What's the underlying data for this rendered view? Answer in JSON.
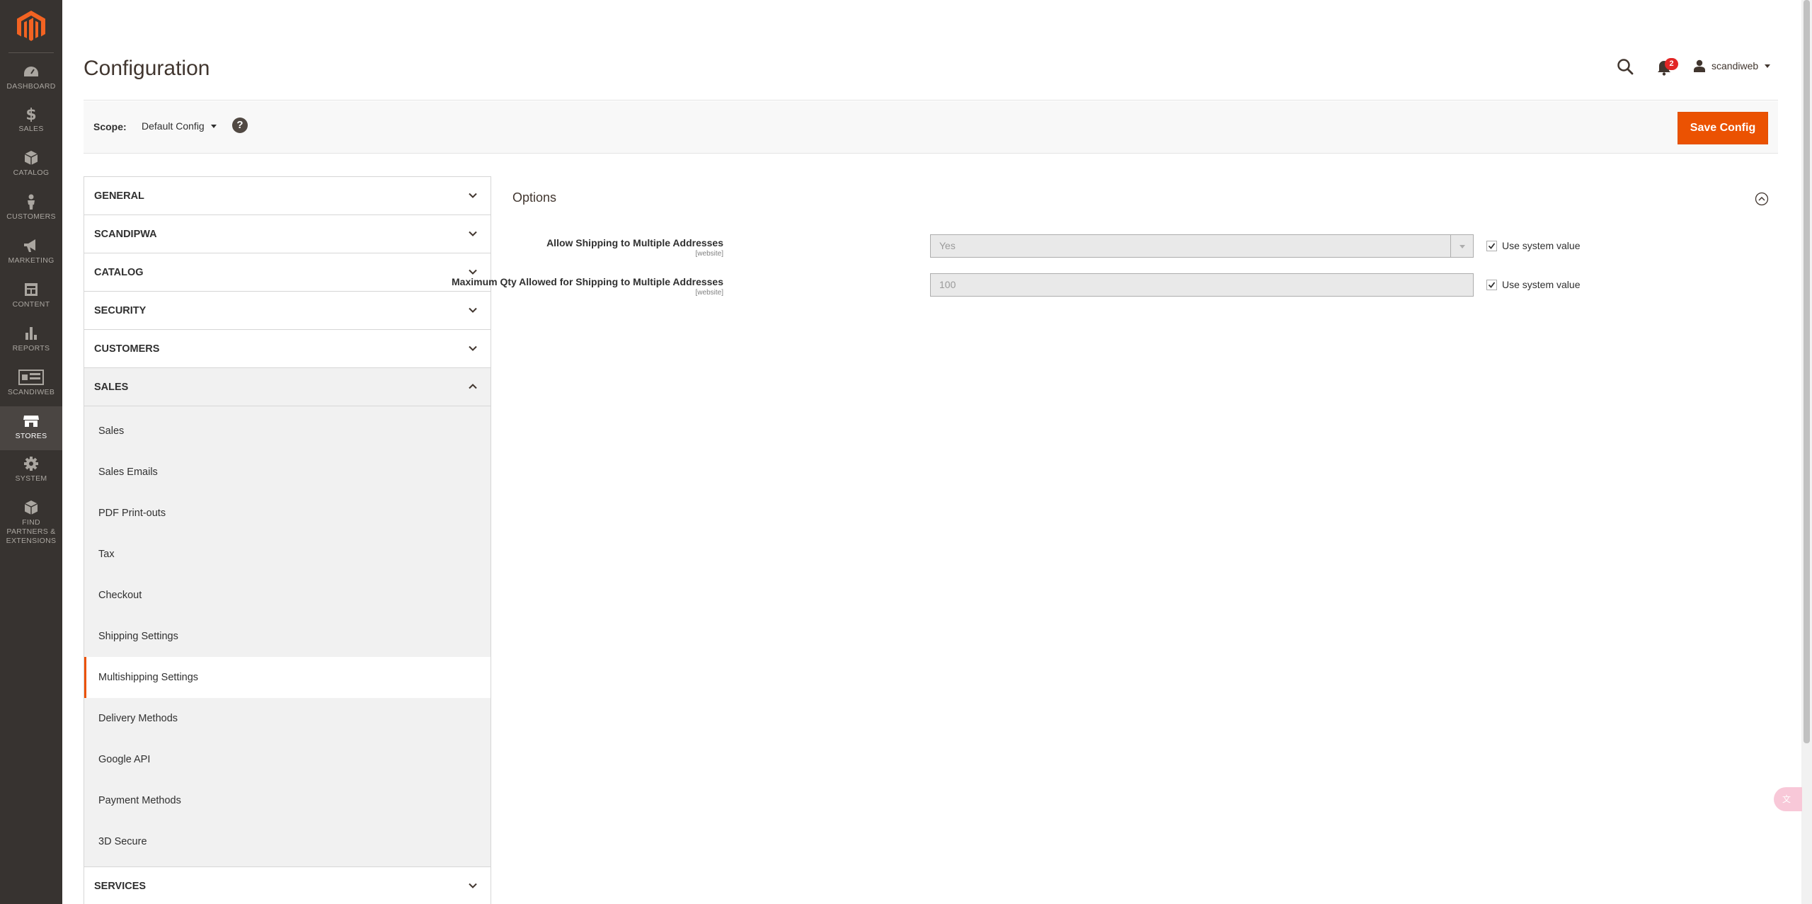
{
  "menu": {
    "items": [
      {
        "label": "DASHBOARD",
        "icon": "dashboard-icon"
      },
      {
        "label": "SALES",
        "icon": "dollar-icon"
      },
      {
        "label": "CATALOG",
        "icon": "box-icon"
      },
      {
        "label": "CUSTOMERS",
        "icon": "person-icon"
      },
      {
        "label": "MARKETING",
        "icon": "megaphone-icon"
      },
      {
        "label": "CONTENT",
        "icon": "layout-icon"
      },
      {
        "label": "REPORTS",
        "icon": "bar-chart-icon"
      },
      {
        "label": "SCANDIWEB",
        "icon": "storefront-icon"
      },
      {
        "label": "STORES",
        "icon": "store-icon"
      },
      {
        "label": "SYSTEM",
        "icon": "gear-icon"
      },
      {
        "label": "FIND PARTNERS & EXTENSIONS",
        "icon": "cubes-icon"
      }
    ]
  },
  "header": {
    "title": "Configuration",
    "notification_count": "2",
    "user_name": "scandiweb"
  },
  "scope": {
    "label": "Scope:",
    "value": "Default Config",
    "help": "?"
  },
  "actions": {
    "save_label": "Save Config"
  },
  "nav": {
    "tabs": [
      {
        "label": "GENERAL"
      },
      {
        "label": "SCANDIPWA"
      },
      {
        "label": "CATALOG"
      },
      {
        "label": "SECURITY"
      },
      {
        "label": "CUSTOMERS"
      },
      {
        "label": "SALES"
      },
      {
        "label": "SERVICES"
      }
    ],
    "sales_items": [
      "Sales",
      "Sales Emails",
      "PDF Print-outs",
      "Tax",
      "Checkout",
      "Shipping Settings",
      "Multishipping Settings",
      "Delivery Methods",
      "Google API",
      "Payment Methods",
      "3D Secure"
    ],
    "active_item": "Multishipping Settings"
  },
  "section": {
    "title": "Options",
    "fields": [
      {
        "label": "Allow Shipping to Multiple Addresses",
        "scope": "[website]",
        "value": "Yes",
        "type": "select",
        "use_system": "Use system value",
        "use_system_checked": true
      },
      {
        "label": "Maximum Qty Allowed for Shipping to Multiple Addresses",
        "scope": "[website]",
        "value": "100",
        "type": "text",
        "use_system": "Use system value",
        "use_system_checked": true
      }
    ]
  },
  "colors": {
    "menu_bg": "#373330",
    "accent": "#eb5202",
    "logo": "#f26322",
    "badge": "#e22626"
  }
}
